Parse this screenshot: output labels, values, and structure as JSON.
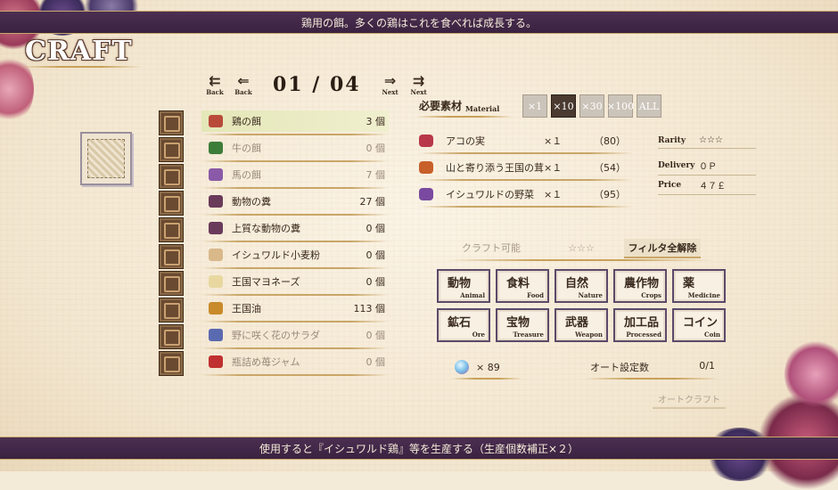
{
  "header": {
    "description": "鶏用の餌。多くの鶏はこれを食べれば成長する。"
  },
  "screen_title": "CRAFT",
  "pager": {
    "back_far": "Back",
    "back": "Back",
    "page": "01 / 04",
    "next": "Next",
    "next_far": "Next"
  },
  "items": [
    {
      "name": "鶏の餌",
      "count": "3 個",
      "color": "#b94a3a",
      "selected": true,
      "dim": false
    },
    {
      "name": "牛の餌",
      "count": "0 個",
      "color": "#3d7d3a",
      "selected": false,
      "dim": true
    },
    {
      "name": "馬の餌",
      "count": "7 個",
      "color": "#8a5aa8",
      "selected": false,
      "dim": true
    },
    {
      "name": "動物の糞",
      "count": "27 個",
      "color": "#6a3a5a",
      "selected": false,
      "dim": false
    },
    {
      "name": "上質な動物の糞",
      "count": "0 個",
      "color": "#6a3a5a",
      "selected": false,
      "dim": false
    },
    {
      "name": "イシュワルド小麦粉",
      "count": "0 個",
      "color": "#d9b98a",
      "selected": false,
      "dim": false
    },
    {
      "name": "王国マヨネーズ",
      "count": "0 個",
      "color": "#e8d8a0",
      "selected": false,
      "dim": false
    },
    {
      "name": "王国油",
      "count": "113 個",
      "color": "#c98a2a",
      "selected": false,
      "dim": false
    },
    {
      "name": "野に咲く花のサラダ",
      "count": "0 個",
      "color": "#5a6ab0",
      "selected": false,
      "dim": true
    },
    {
      "name": "瓶詰め苺ジャム",
      "count": "0 個",
      "color": "#c03030",
      "selected": false,
      "dim": true
    }
  ],
  "materials_header": {
    "jp": "必要素材",
    "en": "Material"
  },
  "multipliers": [
    {
      "label": "×1",
      "active": false
    },
    {
      "label": "×10",
      "active": true
    },
    {
      "label": "×30",
      "active": false
    },
    {
      "label": "×100",
      "active": false
    },
    {
      "label": "ALL",
      "active": false
    }
  ],
  "materials": [
    {
      "name": "アコの実",
      "qty": "×１",
      "owned": "（80）",
      "color": "#b8384a"
    },
    {
      "name": "山と寄り添う王国の茸",
      "qty": "×１",
      "owned": "（54）",
      "color": "#c8602a"
    },
    {
      "name": "イシュワルドの野菜",
      "qty": "×１",
      "owned": "（95）",
      "color": "#7a4aa0"
    }
  ],
  "stats": [
    {
      "key": "Rarity",
      "value": "☆☆☆"
    },
    {
      "key": "Delivery",
      "value": "０Ｐ"
    },
    {
      "key": "Price",
      "value": "４７￡"
    }
  ],
  "filters": {
    "craftable": "クラフト可能",
    "stars": "☆☆☆",
    "clear": "フィルタ全解除"
  },
  "categories": [
    {
      "jp": "動物",
      "en": "Animal"
    },
    {
      "jp": "食料",
      "en": "Food"
    },
    {
      "jp": "自然",
      "en": "Nature"
    },
    {
      "jp": "農作物",
      "en": "Crops"
    },
    {
      "jp": "薬",
      "en": "Medicine"
    },
    {
      "jp": "鉱石",
      "en": "Ore"
    },
    {
      "jp": "宝物",
      "en": "Treasure"
    },
    {
      "jp": "武器",
      "en": "Weapon"
    },
    {
      "jp": "加工品",
      "en": "Processed"
    },
    {
      "jp": "コイン",
      "en": "Coin"
    }
  ],
  "currency": {
    "amount": "× 89"
  },
  "auto": {
    "label": "オート設定数",
    "value": "0/1",
    "button": "オートクラフト"
  },
  "footer": {
    "effect": "使用すると『イシュワルド鶏』等を生産する（生産個数補正×２）"
  }
}
